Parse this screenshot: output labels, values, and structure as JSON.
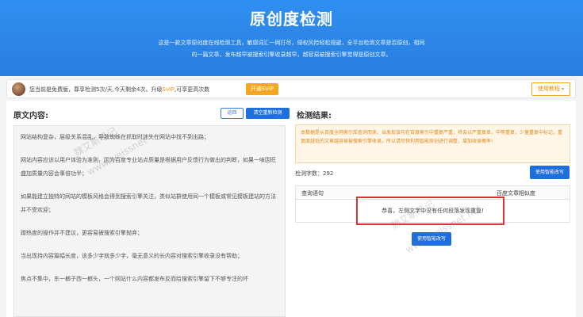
{
  "hero": {
    "title": "原创度检测",
    "desc_line1": "这是一款文章原创度在线检测工具，敏感词汇一网打尽，侵权风险轻松规避，全平台检测文章是否原创，相同",
    "desc_line2": "的一篇文章，发布越早被搜索引擎收录越早，越容易被搜索引擎觉得是原创文章。"
  },
  "status": {
    "text_before": "您当前是免费版，尊享检测5次/天,今天剩余4次。升级",
    "svip_word": "SVIP",
    "text_after": ",可享更高次数",
    "open_svip_label": "开通SVIP",
    "guide_label": "使用教程"
  },
  "left": {
    "title": "原文内容:",
    "back_label": "返回",
    "clear_label": "清空重新检测",
    "paragraphs": [
      "网站结构复杂，层级关系混乱，导致蜘蛛在抓取时迷失在网站中找不到出路；",
      "网站内容应该以用户体验为准则，因为百度专业站点质量是根据用户反馈行为做出的判断，如果一味因旺盛加质量内容会事倍功半；",
      "如果能建立独特的网站的模板风格会得到搜索引擎关注，类似站群使用同一个模板或常见模板建站的方法并不受欢迎；",
      "蹭热度的操作并不建议，更容易被搜索引擎抛弃；",
      "当出现持内容篇幅长度，该多少字就多少字，毫无意义的长内容对搜索引擎收录没有帮助；",
      "焦点不集中，东一榔子西一榔头，一个网站什么内容都发布反而给搜索引擎留下不够专注的坏"
    ]
  },
  "right": {
    "title": "检测结果:",
    "notice": "本数据是从百度全网索引库查询而来，当发现该句在百度索引中重复严重，将会以严重复显，中等重复，少量重复中标记，重复度越低的文章越容易被搜索引擎收录。所以请尽快利用智能原创进行调整，增加收录概率!",
    "count_label": "检测字数：292",
    "smart_label": "使用智能改写",
    "table_headers": [
      "查询语句",
      "百度文章相似度"
    ],
    "empty_message": "恭喜，左侧文字中没有任何段落发现重复!",
    "smart_label_bottom": "使用智能改写"
  },
  "watermarks": [
    "魏艾斯笔记",
    "www.weissnet",
    "魏艾斯笔记",
    "www.weissnet.net"
  ]
}
